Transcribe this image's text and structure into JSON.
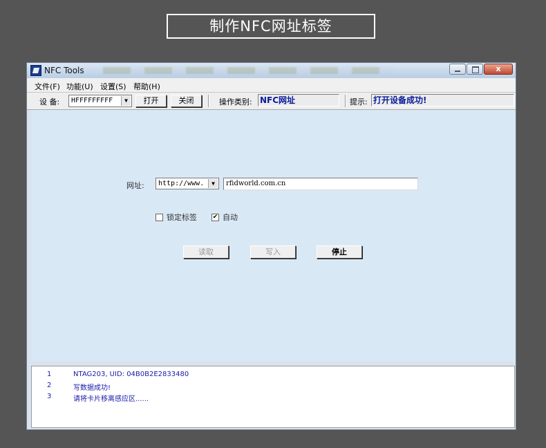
{
  "banner": {
    "title": "制作NFC网址标签"
  },
  "window": {
    "title": "NFC Tools",
    "controls": {
      "close_glyph": "x"
    }
  },
  "menu": {
    "items": [
      "文件(F)",
      "功能(U)",
      "设置(S)",
      "帮助(H)"
    ]
  },
  "toolbar": {
    "device_label": "设  备:",
    "device_value": "HFFFFFFFFF",
    "open_label": "打开",
    "close_label": "关闭",
    "op_type_label": "操作类别:",
    "op_type_value": "NFC网址",
    "hint_label": "提示:",
    "hint_value": "打开设备成功!"
  },
  "form": {
    "url_label": "网址:",
    "url_prefix": "http://www.",
    "url_value": "rfidworld.com.cn",
    "lock_label": "锁定标签",
    "lock_checked": false,
    "auto_label": "自动",
    "auto_checked": true,
    "read_label": "读取",
    "write_label": "写入",
    "stop_label": "停止"
  },
  "log": {
    "entries": [
      {
        "num": "1",
        "text": "NTAG203, UID: 04B0B2E2833480"
      },
      {
        "num": "2",
        "text": "写数据成功!"
      },
      {
        "num": "3",
        "text": "请将卡片移离感应区......"
      }
    ]
  },
  "colors": {
    "background": "#555555",
    "main_area": "#d9e8f5",
    "highlight_text": "#0a1a9a",
    "log_text": "#1a1aa8"
  }
}
